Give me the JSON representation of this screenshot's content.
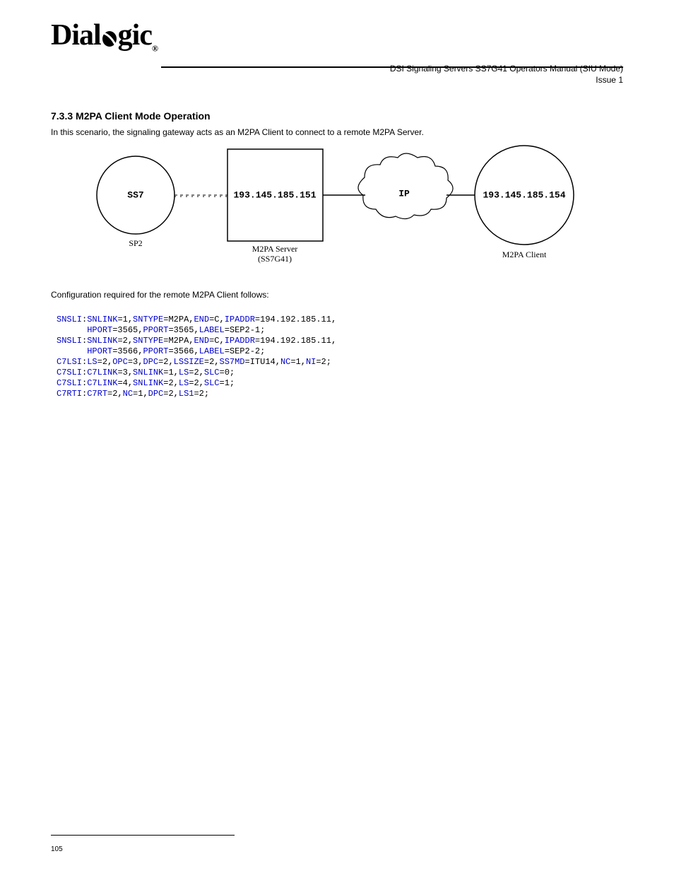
{
  "header": {
    "logo_main": "Dial",
    "logo_mid": "o",
    "logo_end": "gic",
    "doc_title": "DSI Signaling Servers SS7G41 Operators Manual (SIU Mode)",
    "issue": "Issue 1"
  },
  "section": {
    "heading": "7.3.3  M2PA Client Mode Operation",
    "lead_in": "In this scenario, the signaling gateway acts as an M2PA Client to connect to a remote M2PA Server."
  },
  "diagram": {
    "node_ss7": "SS7",
    "node_ss7_sub": "SP2",
    "node_server": "193.145.185.151",
    "node_server_sub": "M2PA Server",
    "node_server_sub2": "(SS7G41)",
    "cloud": "IP",
    "node_client": "193.145.185.154",
    "node_client_sub": "M2PA Client"
  },
  "config": {
    "intro": "Configuration required for the remote M2PA Client follows:",
    "lines": [
      {
        "prefix": "SNSLI",
        "parts": [
          [
            "SNLINK",
            "1"
          ],
          [
            "SNTYPE",
            "M2PA"
          ],
          [
            "END",
            "C"
          ],
          [
            "IPADDR",
            "194.192.185.11"
          ]
        ]
      },
      {
        "indent": true,
        "parts": [
          [
            "HPORT",
            "3565"
          ],
          [
            "PPORT",
            "3565"
          ],
          [
            "LABEL",
            "SEP2-1"
          ]
        ],
        "terminator": ";"
      },
      {
        "prefix": "SNSLI",
        "parts": [
          [
            "SNLINK",
            "2"
          ],
          [
            "SNTYPE",
            "M2PA"
          ],
          [
            "END",
            "C"
          ],
          [
            "IPADDR",
            "194.192.185.11"
          ]
        ]
      },
      {
        "indent": true,
        "parts": [
          [
            "HPORT",
            "3566"
          ],
          [
            "PPORT",
            "3566"
          ],
          [
            "LABEL",
            "SEP2-2"
          ]
        ],
        "terminator": ";"
      },
      {
        "prefix": "C7LSI",
        "parts": [
          [
            "LS",
            "2"
          ],
          [
            "OPC",
            "3"
          ],
          [
            "DPC",
            "2"
          ],
          [
            "LSSIZE",
            "2"
          ],
          [
            "SS7MD",
            "ITU14"
          ],
          [
            "NC",
            "1"
          ],
          [
            "NI",
            "2"
          ]
        ],
        "terminator": ";"
      },
      {
        "prefix": "C7SLI",
        "parts": [
          [
            "C7LINK",
            "3"
          ],
          [
            "SNLINK",
            "1"
          ],
          [
            "LS",
            "2"
          ],
          [
            "SLC",
            "0"
          ]
        ],
        "terminator": ";"
      },
      {
        "prefix": "C7SLI",
        "parts": [
          [
            "C7LINK",
            "4"
          ],
          [
            "SNLINK",
            "2"
          ],
          [
            "LS",
            "2"
          ],
          [
            "SLC",
            "1"
          ]
        ],
        "terminator": ";"
      },
      {
        "prefix": "C7RTI",
        "parts": [
          [
            "C7RT",
            "2"
          ],
          [
            "NC",
            "1"
          ],
          [
            "DPC",
            "2"
          ],
          [
            "LS1",
            "2"
          ]
        ],
        "terminator": ";"
      }
    ]
  },
  "footer": {
    "pageno": "105"
  }
}
